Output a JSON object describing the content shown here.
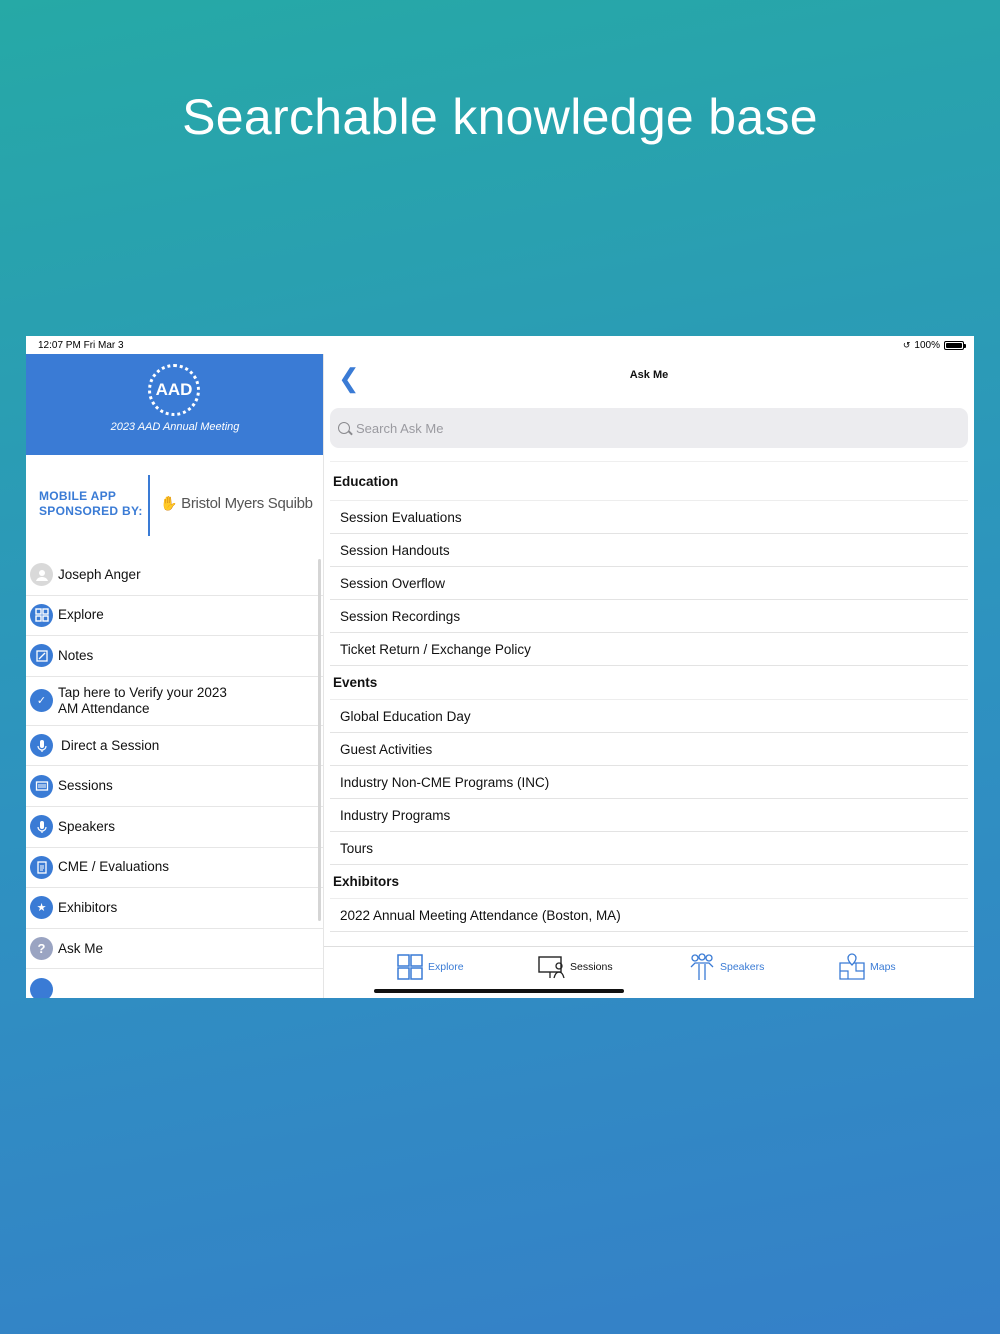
{
  "headline": "Searchable knowledge base",
  "status": {
    "time": "12:07 PM   Fri Mar 3",
    "battery": "100%"
  },
  "sidebar": {
    "logo_text": "AAD",
    "meeting_title": "2023 AAD Annual Meeting",
    "sponsor_label": "MOBILE APP SPONSORED BY:",
    "sponsor_name": "Bristol Myers Squibb",
    "items": [
      {
        "label": "Joseph Anger",
        "icon": "user-icon"
      },
      {
        "label": "Explore",
        "icon": "grid-icon"
      },
      {
        "label": "Notes",
        "icon": "notes-icon"
      },
      {
        "label": "Tap here to Verify your 2023 AM Attendance",
        "icon": "verify-icon"
      },
      {
        "label": "Direct a Session",
        "icon": "microphone-icon"
      },
      {
        "label": "Sessions",
        "icon": "sessions-icon"
      },
      {
        "label": "Speakers",
        "icon": "microphone-icon"
      },
      {
        "label": "CME / Evaluations",
        "icon": "clipboard-icon"
      },
      {
        "label": "Exhibitors",
        "icon": "exhibitors-icon"
      },
      {
        "label": "Ask Me",
        "icon": "question-icon"
      }
    ]
  },
  "main": {
    "title": "Ask Me",
    "search_placeholder": "Search Ask Me",
    "sections": [
      {
        "title": "Education",
        "items": [
          "Session Evaluations",
          "Session Handouts",
          "Session Overflow",
          "Session Recordings",
          "Ticket Return / Exchange Policy"
        ]
      },
      {
        "title": "Events",
        "items": [
          "Global Education Day",
          "Guest Activities",
          "Industry Non-CME Programs (INC)",
          "Industry Programs",
          "Tours"
        ]
      },
      {
        "title": "Exhibitors",
        "items": [
          "2022 Annual Meeting Attendance (Boston, MA)"
        ]
      }
    ]
  },
  "tabbar": {
    "tabs": [
      {
        "label": "Explore",
        "icon": "grid-icon"
      },
      {
        "label": "Sessions",
        "icon": "presentation-icon"
      },
      {
        "label": "Speakers",
        "icon": "speakers-icon"
      },
      {
        "label": "Maps",
        "icon": "map-icon"
      }
    ]
  },
  "colors": {
    "brand": "#3a7bd5",
    "sponsor_accent": "#be2a6e"
  }
}
